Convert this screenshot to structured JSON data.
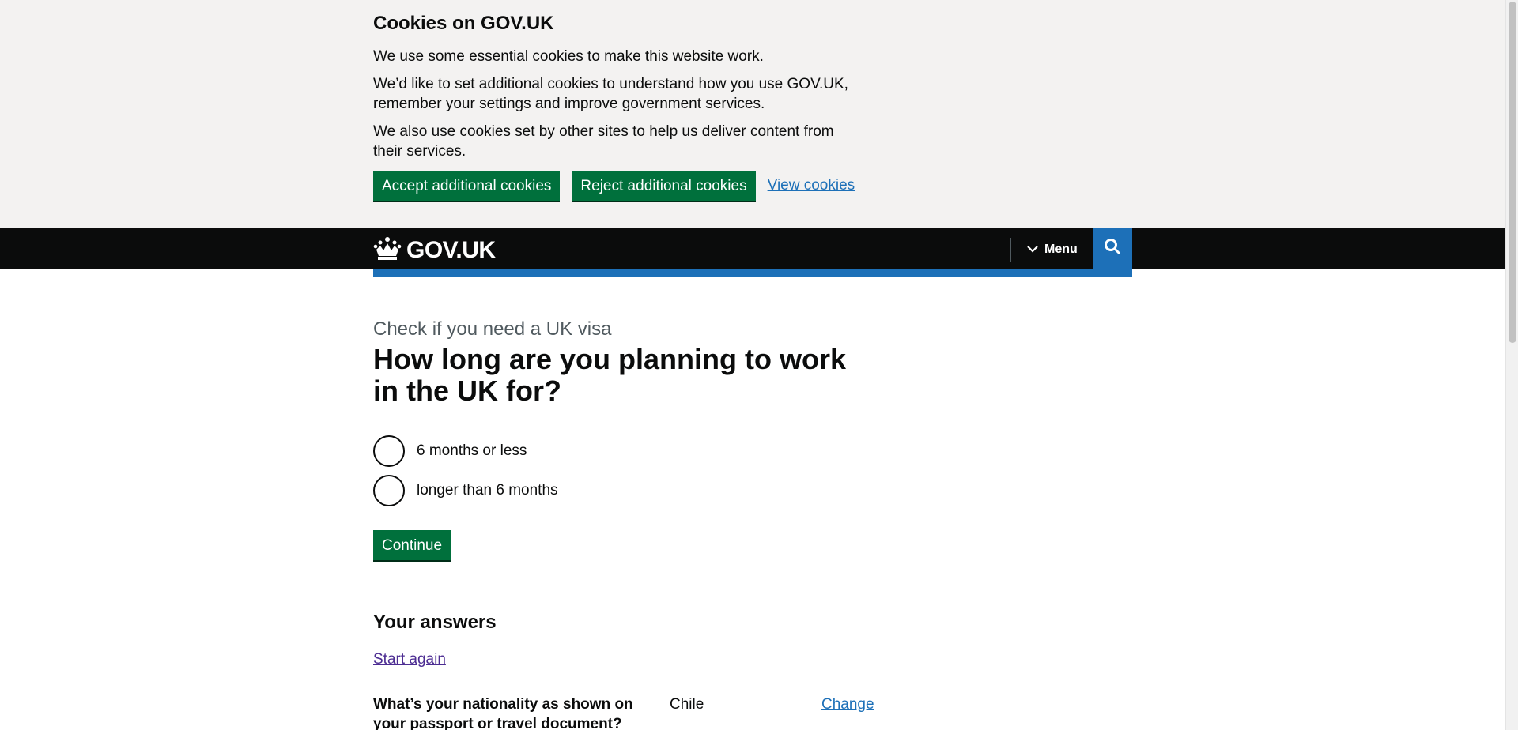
{
  "cookie_banner": {
    "title": "Cookies on GOV.UK",
    "p1": "We use some essential cookies to make this website work.",
    "p2": "We’d like to set additional cookies to understand how you use GOV.UK, remember your settings and improve government services.",
    "p3": "We also use cookies set by other sites to help us deliver content from their services.",
    "accept_label": "Accept additional cookies",
    "reject_label": "Reject additional cookies",
    "view_label": "View cookies"
  },
  "header": {
    "logo_text": "GOV.UK",
    "menu_label": "Menu",
    "search_icon": "search-icon",
    "crown_icon": "crown-icon"
  },
  "main": {
    "caption": "Check if you need a UK visa",
    "heading": "How long are you planning to work in the UK for?",
    "options": [
      "6 months or less",
      "longer than 6 months"
    ],
    "continue_label": "Continue",
    "answers_heading": "Your answers",
    "start_again": "Start again",
    "summary": [
      {
        "question": "What’s your nationality as shown on your passport or travel document?",
        "answer": "Chile",
        "action": "Change"
      }
    ]
  },
  "colors": {
    "button_green": "#00703c",
    "brand_blue": "#1d70b8",
    "header_black": "#0b0c0c",
    "banner_grey": "#f3f2f1"
  }
}
